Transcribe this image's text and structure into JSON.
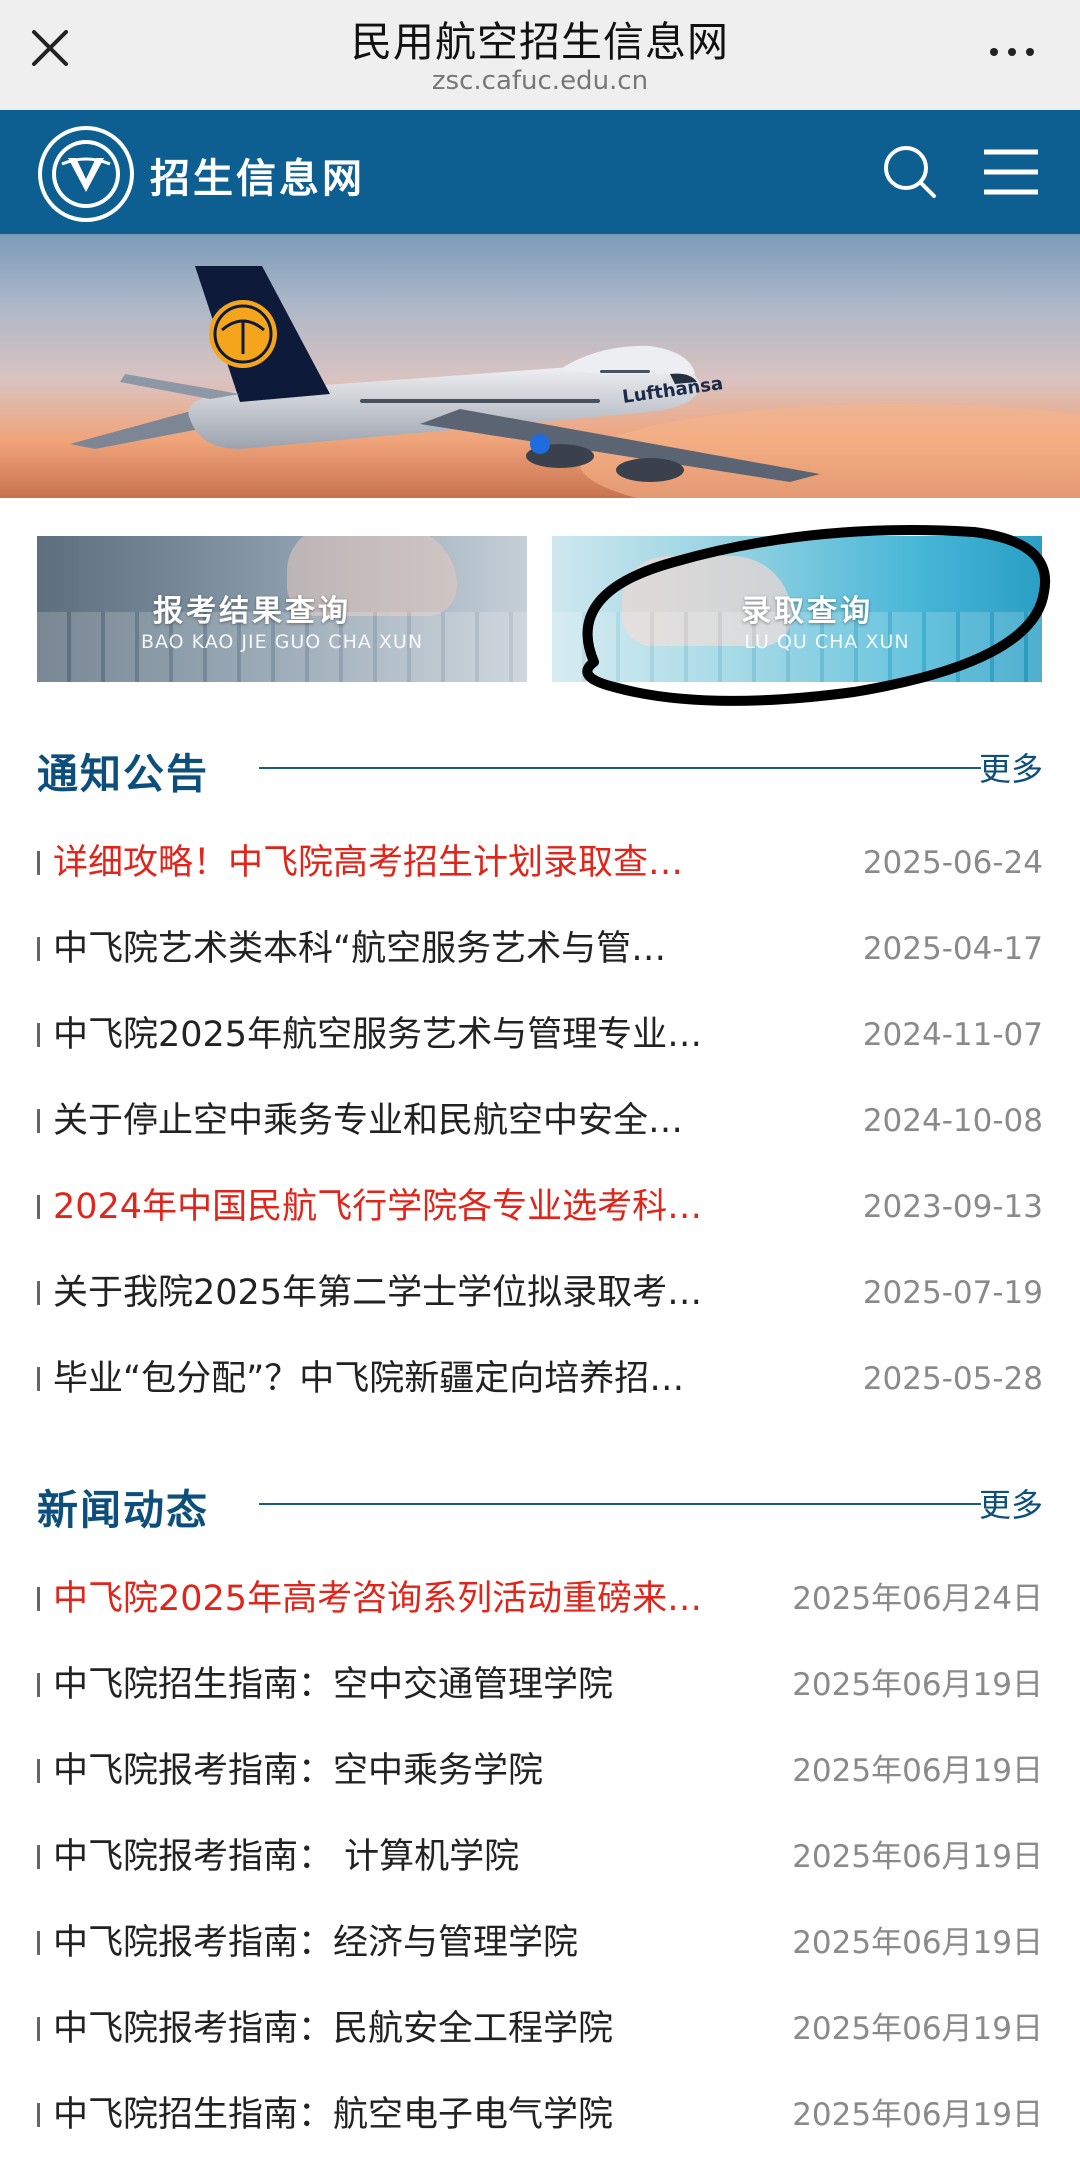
{
  "browser": {
    "title": "民用航空招生信息网",
    "url": "zsc.cafuc.edu.cn"
  },
  "header": {
    "site_name": "招生信息网",
    "icons": [
      "logo-emblem",
      "search-icon",
      "menu-icon"
    ]
  },
  "hero": {
    "image": "airplane-banner",
    "livery_text": "Lufthansa"
  },
  "quick_links": [
    {
      "title": "报考结果查询",
      "subtitle": "BAO KAO JIE GUO CHA XUN"
    },
    {
      "title": "录取查询",
      "subtitle": "LU QU CHA XUN"
    }
  ],
  "notices": {
    "title": "通知公告",
    "more": "更多",
    "items": [
      {
        "text": "详细攻略！中飞院高考招生计划录取查…",
        "date": "2025-06-24",
        "highlight": true
      },
      {
        "text": "中飞院艺术类本科“航空服务艺术与管…",
        "date": "2025-04-17",
        "highlight": false
      },
      {
        "text": "中飞院2025年航空服务艺术与管理专业…",
        "date": "2024-11-07",
        "highlight": false
      },
      {
        "text": "关于停止空中乘务专业和民航空中安全…",
        "date": "2024-10-08",
        "highlight": false
      },
      {
        "text": "2024年中国民航飞行学院各专业选考科…",
        "date": "2023-09-13",
        "highlight": true
      },
      {
        "text": "关于我院2025年第二学士学位拟录取考…",
        "date": "2025-07-19",
        "highlight": false
      },
      {
        "text": "毕业“包分配”？中飞院新疆定向培养招…",
        "date": "2025-05-28",
        "highlight": false
      }
    ]
  },
  "news": {
    "title": "新闻动态",
    "more": "更多",
    "items": [
      {
        "text": "中飞院2025年高考咨询系列活动重磅来…",
        "date": "2025年06月24日",
        "highlight": true
      },
      {
        "text": "中飞院招生指南：空中交通管理学院",
        "date": "2025年06月19日",
        "highlight": false
      },
      {
        "text": "中飞院报考指南：空中乘务学院",
        "date": "2025年06月19日",
        "highlight": false
      },
      {
        "text": "中飞院报考指南： 计算机学院",
        "date": "2025年06月19日",
        "highlight": false
      },
      {
        "text": "中飞院报考指南：经济与管理学院",
        "date": "2025年06月19日",
        "highlight": false
      },
      {
        "text": "中飞院报考指南：民航安全工程学院",
        "date": "2025年06月19日",
        "highlight": false
      },
      {
        "text": "中飞院招生指南：航空电子电气学院",
        "date": "2025年06月19日",
        "highlight": false
      }
    ]
  },
  "colors": {
    "header_bg": "#0d5f92",
    "section_title": "#0d4f7c",
    "highlight_text": "#e0251b",
    "date_text": "#8a8a8a",
    "annotation_circle": "#000000"
  }
}
